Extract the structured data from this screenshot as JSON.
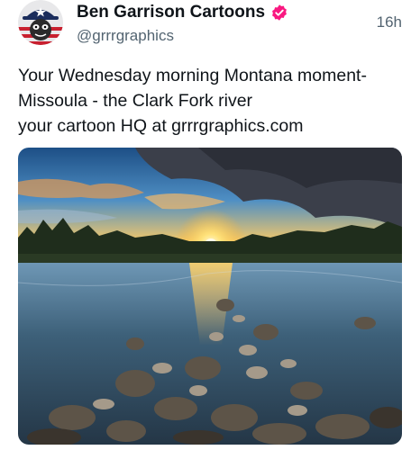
{
  "author": {
    "display_name": "Ben Garrison Cartoons",
    "handle": "@grrrgraphics",
    "verified_icon": "verified-badge-icon"
  },
  "post": {
    "timestamp": "16h",
    "text_lines": [
      "Your Wednesday morning Montana moment-",
      "Missoula - the Clark Fork river",
      "your cartoon HQ at grrrgraphics.com"
    ]
  },
  "media": {
    "kind": "photo",
    "subject": "sunset over a river with rocky shore"
  },
  "colors": {
    "text_primary": "#0f1419",
    "text_secondary": "#536471",
    "verified_badge": "#f91880"
  }
}
